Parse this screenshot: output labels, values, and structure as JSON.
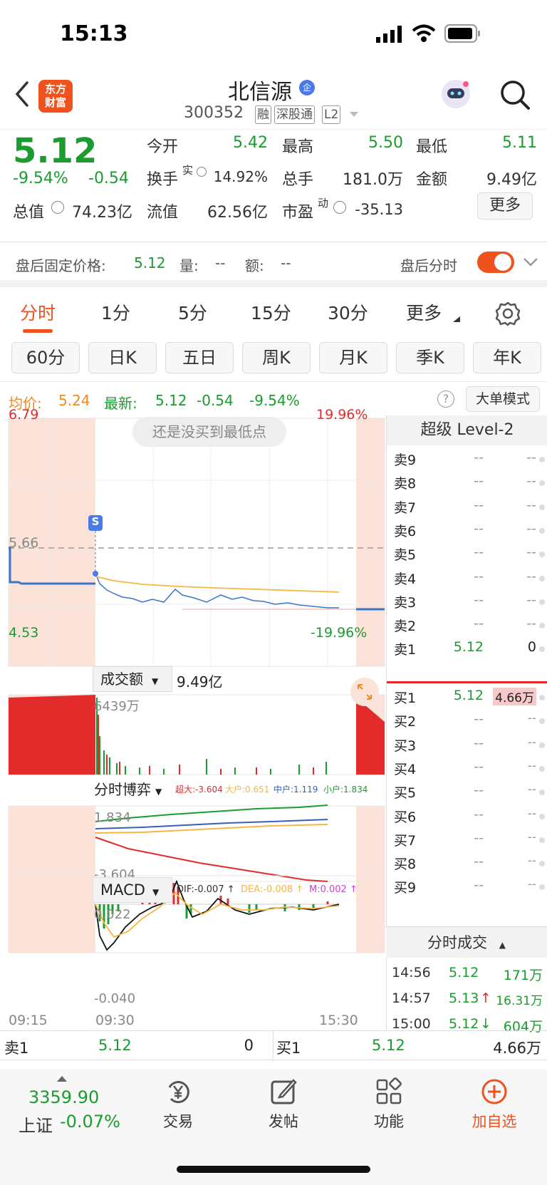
{
  "status_bar": {
    "time": "15:13"
  },
  "header": {
    "logo_text": "东方财富",
    "title": "北信源",
    "title_badge": "企",
    "code": "300352",
    "tags": [
      "融",
      "深股通",
      "L2"
    ]
  },
  "quote": {
    "price": "5.12",
    "change_pct": "-9.54%",
    "change_abs": "-0.54",
    "open_label": "今开",
    "open": "5.42",
    "high_label": "最高",
    "high": "5.50",
    "low_label": "最低",
    "low": "5.11",
    "turnover_label": "换手",
    "turnover_sup": "实",
    "turnover": "14.92%",
    "volume_label": "总手",
    "volume": "181.0万",
    "amount_label": "金额",
    "amount": "9.49亿",
    "mktcap_label": "总值",
    "mktcap": "74.23亿",
    "float_label": "流值",
    "float": "62.56亿",
    "pe_label": "市盈",
    "pe_sup": "动",
    "pe": "-35.13",
    "more_label": "更多"
  },
  "after_hours": {
    "price_label": "盘后固定价格:",
    "price": "5.12",
    "vol_label": "量:",
    "vol": "--",
    "amt_label": "额:",
    "amt": "--",
    "toggle_label": "盘后分时",
    "toggle_on": true
  },
  "tabs": [
    "分时",
    "1分",
    "5分",
    "15分",
    "30分",
    "更多"
  ],
  "active_tab": "分时",
  "tabs2": [
    "60分",
    "日K",
    "五日",
    "周K",
    "月K",
    "季K",
    "年K"
  ],
  "infobar": {
    "avg_label": "均价:",
    "avg": "5.24",
    "latest_label": "最新:",
    "latest": "5.12",
    "change": "-0.54",
    "pct": "-9.54%",
    "help_icon": "?",
    "mode_label": "大单模式"
  },
  "chart": {
    "price_max": "6.79",
    "price_min": "4.53",
    "pct_max": "19.96%",
    "pct_min": "-19.96%",
    "ref_price": "5.66",
    "tooltip": "还是没买到最低点",
    "marker": "S",
    "vol_panel_label": "成交额",
    "vol_total": "9.49亿",
    "vol_max": "6439万",
    "game_label": "分时博弈",
    "game_legend": [
      {
        "text": "超大:-3.604",
        "color": "#e32b2b"
      },
      {
        "text": "大户:0.651",
        "color": "#f5b642"
      },
      {
        "text": "中户:1.119",
        "color": "#3b5fb8"
      },
      {
        "text": "小户:1.834",
        "color": "#1a9c2e"
      }
    ],
    "game_max": "1.834",
    "game_min": "-3.604",
    "macd_label": "MACD",
    "macd_legend": [
      {
        "text": "DIF:-0.007 ↑",
        "color": "#333"
      },
      {
        "text": "DEA:-0.008 ↑",
        "color": "#f5b642"
      },
      {
        "text": "M:0.002 ↑",
        "color": "#d63cd6"
      }
    ],
    "macd_max": "0.022",
    "macd_min": "-0.040",
    "time_labels": [
      "09:15",
      "09:30",
      "15:30"
    ]
  },
  "order_book": {
    "title": "超级 Level-2",
    "asks": [
      {
        "label": "卖9",
        "price": "--",
        "vol": "--"
      },
      {
        "label": "卖8",
        "price": "--",
        "vol": "--"
      },
      {
        "label": "卖7",
        "price": "--",
        "vol": "--"
      },
      {
        "label": "卖6",
        "price": "--",
        "vol": "--"
      },
      {
        "label": "卖5",
        "price": "--",
        "vol": "--"
      },
      {
        "label": "卖4",
        "price": "--",
        "vol": "--"
      },
      {
        "label": "卖3",
        "price": "--",
        "vol": "--"
      },
      {
        "label": "卖2",
        "price": "--",
        "vol": "--"
      },
      {
        "label": "卖1",
        "price": "5.12",
        "vol": "0"
      }
    ],
    "bids": [
      {
        "label": "买1",
        "price": "5.12",
        "vol": "4.66万"
      },
      {
        "label": "买2",
        "price": "--",
        "vol": "--"
      },
      {
        "label": "买3",
        "price": "--",
        "vol": "--"
      },
      {
        "label": "买4",
        "price": "--",
        "vol": "--"
      },
      {
        "label": "买5",
        "price": "--",
        "vol": "--"
      },
      {
        "label": "买6",
        "price": "--",
        "vol": "--"
      },
      {
        "label": "买7",
        "price": "--",
        "vol": "--"
      },
      {
        "label": "买8",
        "price": "--",
        "vol": "--"
      },
      {
        "label": "买9",
        "price": "--",
        "vol": "--"
      }
    ]
  },
  "trades": {
    "title": "分时成交",
    "rows": [
      {
        "time": "14:56",
        "price": "5.12",
        "arrow": "",
        "vol": "171万"
      },
      {
        "time": "14:57",
        "price": "5.13",
        "arrow": "↑",
        "vol": "16.31万"
      },
      {
        "time": "15:00",
        "price": "5.12",
        "arrow": "↓",
        "vol": "604万"
      }
    ]
  },
  "bottom_row": {
    "sell_label": "卖1",
    "sell_price": "5.12",
    "sell_vol": "0",
    "buy_label": "买1",
    "buy_price": "5.12",
    "buy_vol": "4.66万"
  },
  "dock": {
    "index_value": "3359.90",
    "index_name": "上证",
    "index_change": "-0.07%",
    "items": [
      "交易",
      "发帖",
      "功能",
      "加自选"
    ]
  }
}
